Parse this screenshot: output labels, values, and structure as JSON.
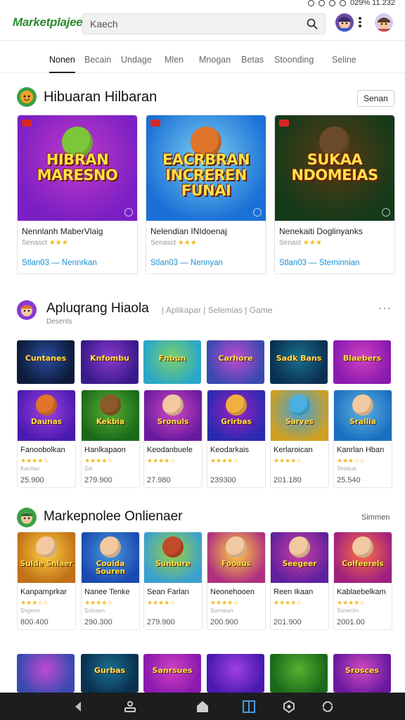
{
  "status": {
    "right_text": "029%  11.232"
  },
  "header": {
    "logo": "Marketplajee",
    "search_value": "Kaech"
  },
  "tabs": [
    "Nonen",
    "Becain",
    "Undage",
    "Mlen",
    "Mnogan",
    "Betas",
    "Stoonding",
    "Seline"
  ],
  "section1": {
    "title": "Hibuaran  Hilbaran",
    "button": "Senan",
    "cards": [
      {
        "art_text": "HIBRAN MARESNO",
        "title": "Nennlanh MaberVlaig",
        "rating": "Senasct",
        "link": "Stlan03 — Nennrkan",
        "palette": [
          "#7a1fc4",
          "#c23ac8"
        ]
      },
      {
        "art_text": "EACRBRAN INCREREN FUNAI",
        "title": "Nelendian INIdoenaj",
        "rating": "Senasct",
        "link": "Stlan03 — Nennyan",
        "palette": [
          "#1c6fd6",
          "#7bd1f2"
        ]
      },
      {
        "art_text": "SUKAA NDOMEIAS",
        "title": "Nenekaiti Doglinyanks",
        "rating": "Senast",
        "link": "Stlan03 — Steminnian",
        "palette": [
          "#143a1a",
          "#5a3a14"
        ]
      }
    ]
  },
  "section2": {
    "title": "Apluqrang Hiaola",
    "subtitle": "Desents",
    "links": "| Aplikapar  | Selemias  |  Game",
    "tiles": [
      "Cuntanes",
      "Knfombu",
      "Fnbun",
      "Carhore",
      "Sadk Bans",
      "Blaebers"
    ],
    "cards": [
      {
        "art": "Daunas",
        "name": "Fanoobolkan",
        "sub": "Kanitau",
        "price": "25.900",
        "stars": "★★★★☆"
      },
      {
        "art": "Kekbia",
        "name": "Hanlkapaon",
        "sub": "Sie",
        "price": "279.900",
        "stars": "★★★★☆"
      },
      {
        "art": "Sronuls",
        "name": "Keodanbuele",
        "sub": "",
        "price": "27.980",
        "stars": "★★★★☆"
      },
      {
        "art": "Grirbas",
        "name": "Keodarkais",
        "sub": "",
        "price": "239300",
        "stars": "★★★★☆"
      },
      {
        "art": "Sarves",
        "name": "Kerlaroican",
        "sub": "",
        "price": "201.180",
        "stars": "★★★★☆"
      },
      {
        "art": "Srallia",
        "name": "Kanrlan Hban",
        "sub": "Sirebua",
        "price": "25.540",
        "stars": "★★★☆☆"
      }
    ]
  },
  "section3": {
    "title": "Markepnolee  Onlienaer",
    "more": "Simmen",
    "cards": [
      {
        "art": "Sulde Snlaer",
        "name": "Kanpamprkar",
        "sub": "Sngenn",
        "price": "800.400",
        "stars": "★★★☆☆"
      },
      {
        "art": "Couida Souren",
        "name": "Nanee Tenke",
        "sub": "Sstnsen",
        "price": "290.300",
        "stars": "★★★★☆"
      },
      {
        "art": "Sunbure",
        "name": "Sean Farlan",
        "sub": "",
        "price": "279.900",
        "stars": "★★★★☆"
      },
      {
        "art": "Fooaus",
        "name": "Neonehooen",
        "sub": "Sormeun",
        "price": "200.900",
        "stars": "★★★★☆"
      },
      {
        "art": "Seegeer",
        "name": "Reen Ikaan",
        "sub": "",
        "price": "201.900",
        "stars": "★★★★☆"
      },
      {
        "art": "Colfeerels",
        "name": "Kablaebelkam",
        "sub": "Sonecim",
        "price": "2001.00",
        "stars": "★★★★☆"
      }
    ],
    "row4": [
      "",
      "Gurbas",
      "Sanrsues",
      "",
      "",
      "Srosces"
    ]
  },
  "colors": {
    "tile_palettes": [
      [
        "#0d1a3a",
        "#2a4ea0"
      ],
      [
        "#3a1a8a",
        "#8a3ad0"
      ],
      [
        "#2aa7c8",
        "#7ad06a"
      ],
      [
        "#3a4ab0",
        "#c04ad0"
      ],
      [
        "#0a3050",
        "#1a7090"
      ],
      [
        "#8a1ab0",
        "#d040c0"
      ],
      [
        "#4a1ab0",
        "#a040e0"
      ],
      [
        "#1a6a1a",
        "#5ab030"
      ],
      [
        "#6a1aa0",
        "#d04ac0"
      ],
      [
        "#2a2ab0",
        "#a020c0"
      ],
      [
        "#d0a020",
        "#40a0e0"
      ],
      [
        "#1a70c0",
        "#60b0e0"
      ],
      [
        "#c07018",
        "#ffd040"
      ],
      [
        "#1a4ab0",
        "#4a9ae0"
      ],
      [
        "#3aa0d0",
        "#9ad040"
      ],
      [
        "#b03080",
        "#ffd040"
      ],
      [
        "#6020a0",
        "#d040a0"
      ],
      [
        "#a02080",
        "#ff7040"
      ]
    ],
    "accent_link": "#1a8fd6",
    "star": "#f3b922"
  },
  "nav": [
    "back-icon",
    "home-profile-icon",
    "house-icon",
    "book-icon",
    "badge-icon",
    "refresh-icon"
  ]
}
